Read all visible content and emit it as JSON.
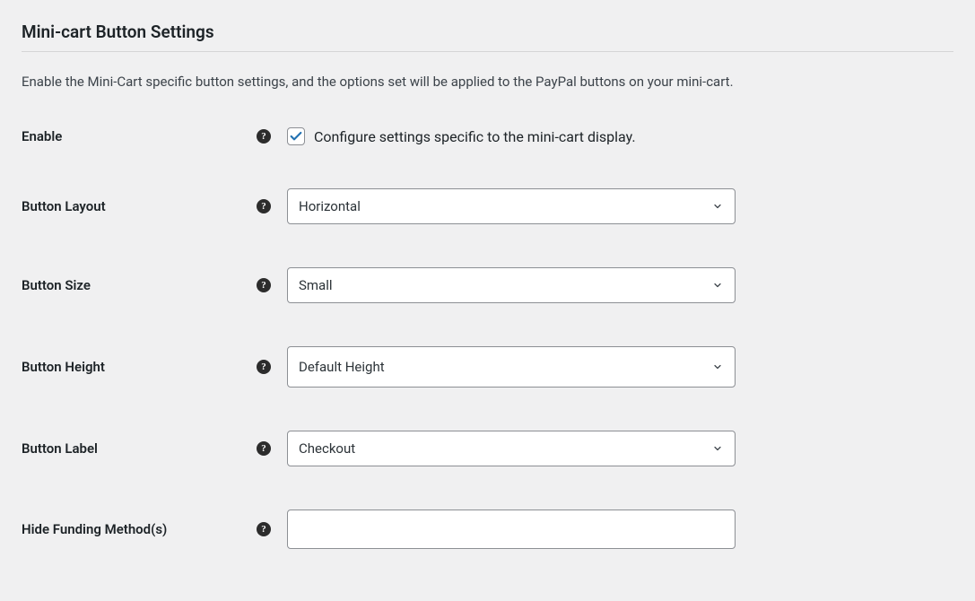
{
  "section": {
    "title": "Mini-cart Button Settings",
    "description": "Enable the Mini-Cart specific button settings, and the options set will be applied to the PayPal buttons on your mini-cart."
  },
  "help_glyph": "?",
  "fields": {
    "enable": {
      "label": "Enable",
      "checkbox_label": "Configure settings specific to the mini-cart display.",
      "checked": true
    },
    "button_layout": {
      "label": "Button Layout",
      "value": "Horizontal"
    },
    "button_size": {
      "label": "Button Size",
      "value": "Small"
    },
    "button_height": {
      "label": "Button Height",
      "value": "Default Height"
    },
    "button_label": {
      "label": "Button Label",
      "value": "Checkout"
    },
    "hide_funding": {
      "label": "Hide Funding Method(s)",
      "value": ""
    }
  }
}
